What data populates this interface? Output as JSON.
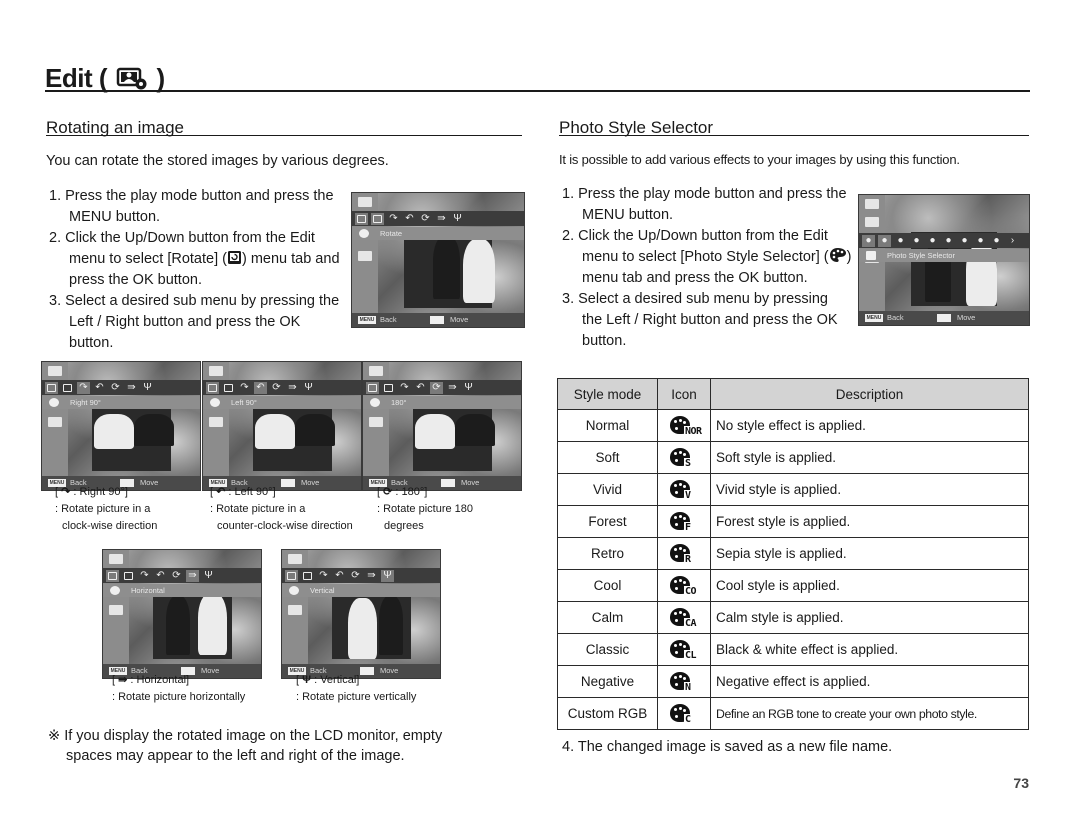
{
  "page": {
    "title": "Edit (",
    "title_close": ")",
    "title_icon": "edit-photo-icon",
    "page_number": "73"
  },
  "rotate": {
    "heading": "Rotating an image",
    "intro": "You can rotate the stored images by various degrees.",
    "steps": [
      "1. Press the play mode button and press the MENU button.",
      "2. Click the Up/Down button from the Edit menu to select [Rotate] (",
      ") menu tab and press the OK button.",
      "3. Select a desired sub menu by pressing the Left / Right button and press the OK button."
    ],
    "step2_icon": "rotate-icon",
    "main_screen": {
      "label": "Rotate",
      "back": "Back",
      "move": "Move",
      "menu_key": "MENU"
    },
    "options": [
      {
        "icon": "rotate-right-icon",
        "glyph": "↷",
        "name": "Right 90°",
        "screen_label": "Right 90°",
        "desc1": ": Rotate picture in a",
        "desc2": "clock-wise direction"
      },
      {
        "icon": "rotate-left-icon",
        "glyph": "↶",
        "name": "Left 90°",
        "screen_label": "Left 90°",
        "desc1": ": Rotate picture in a",
        "desc2": "counter-clock-wise direction"
      },
      {
        "icon": "rotate-180-icon",
        "glyph": "⟳",
        "name": "180°",
        "screen_label": "180°",
        "desc1": ": Rotate picture 180",
        "desc2": "degrees"
      },
      {
        "icon": "flip-horizontal-icon",
        "glyph": "⇛",
        "name": "Horizontal",
        "screen_label": "Horizontal",
        "desc1": ": Rotate picture horizontally",
        "desc2": ""
      },
      {
        "icon": "flip-vertical-icon",
        "glyph": "Ψ",
        "name": "Vertical",
        "screen_label": "Vertical",
        "desc1": ": Rotate picture vertically",
        "desc2": ""
      }
    ],
    "note_mark": "※",
    "note": "If you display the rotated image on the LCD monitor, empty spaces may appear to the left and right of the image."
  },
  "style": {
    "heading": "Photo Style Selector",
    "intro": "It is possible to add various effects to your images by using this function.",
    "steps": [
      "1. Press the play mode button and press the MENU button.",
      "2. Click the Up/Down button from the Edit menu to select [Photo Style Selector] (",
      ") menu tab and press the OK button.",
      "3. Select a desired sub menu by pressing the Left / Right button and press the OK button."
    ],
    "step2_icon": "palette-icon",
    "screen": {
      "label": "Photo Style Selector",
      "back": "Back",
      "move": "Move",
      "menu_key": "MENU"
    },
    "table": {
      "headers": [
        "Style mode",
        "Icon",
        "Description"
      ],
      "rows": [
        {
          "mode": "Normal",
          "icon": "style-normal-icon",
          "suffix": "NOR",
          "desc": "No style effect is applied."
        },
        {
          "mode": "Soft",
          "icon": "style-soft-icon",
          "suffix": "S",
          "desc": "Soft style is applied."
        },
        {
          "mode": "Vivid",
          "icon": "style-vivid-icon",
          "suffix": "V",
          "desc": "Vivid style is applied."
        },
        {
          "mode": "Forest",
          "icon": "style-forest-icon",
          "suffix": "F",
          "desc": "Forest style is applied."
        },
        {
          "mode": "Retro",
          "icon": "style-retro-icon",
          "suffix": "R",
          "desc": "Sepia style is applied."
        },
        {
          "mode": "Cool",
          "icon": "style-cool-icon",
          "suffix": "CO",
          "desc": "Cool style is applied."
        },
        {
          "mode": "Calm",
          "icon": "style-calm-icon",
          "suffix": "CA",
          "desc": "Calm style is applied."
        },
        {
          "mode": "Classic",
          "icon": "style-classic-icon",
          "suffix": "CL",
          "desc": "Black & white effect is applied."
        },
        {
          "mode": "Negative",
          "icon": "style-negative-icon",
          "suffix": "N",
          "desc": "Negative effect is applied."
        },
        {
          "mode": "Custom RGB",
          "icon": "style-custom-rgb-icon",
          "suffix": "C",
          "desc": "Define an RGB tone to create your own photo style."
        }
      ]
    },
    "step4": "4. The changed image is saved as a new file name."
  }
}
